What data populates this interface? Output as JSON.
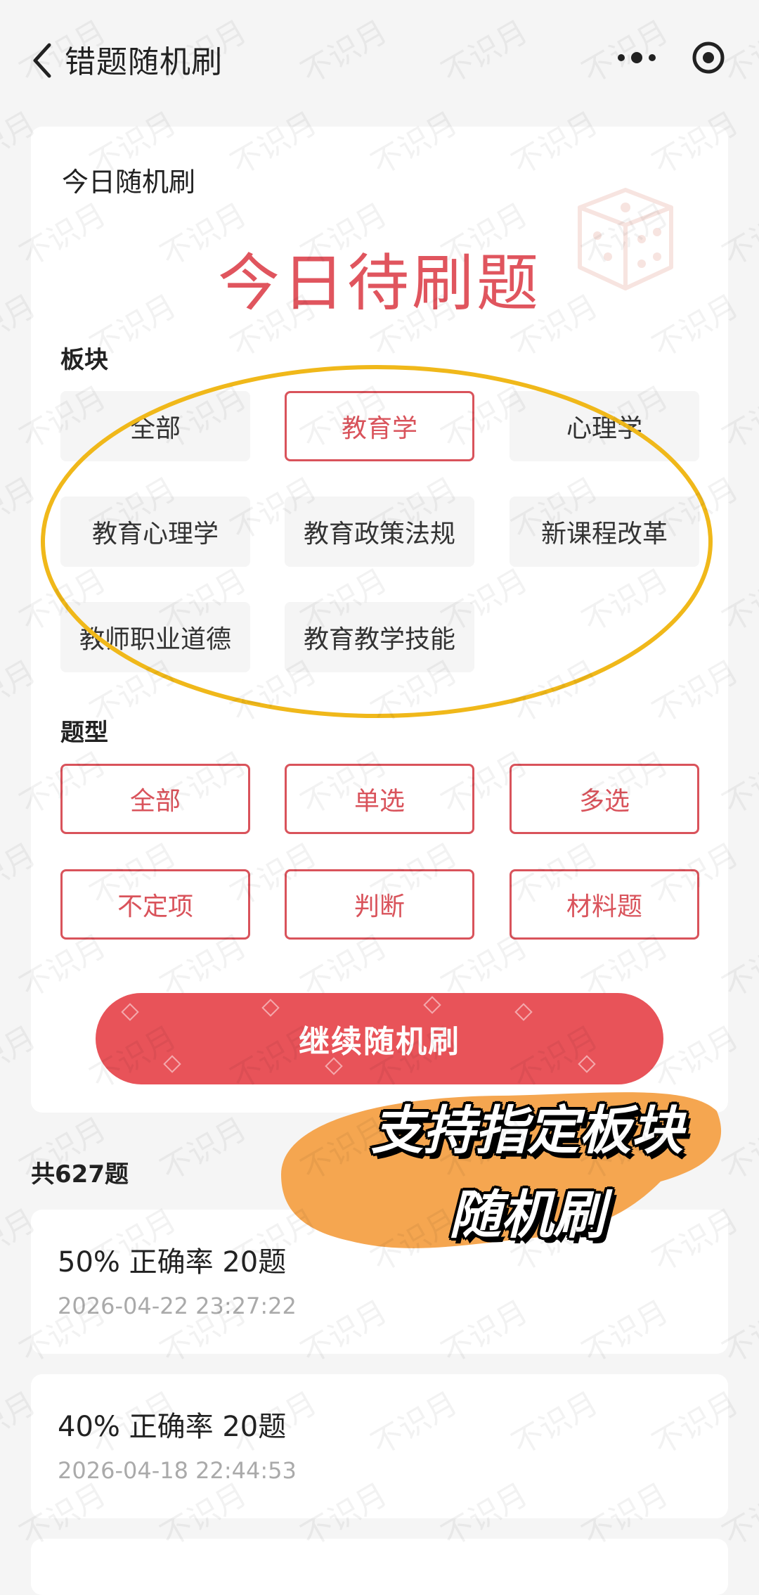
{
  "nav": {
    "title": "错题随机刷",
    "icons": [
      "back-chevron",
      "more-dots",
      "target-circle"
    ]
  },
  "main_card": {
    "label": "今日随机刷",
    "big_title": "今日待刷题",
    "section_block": "板块",
    "blocks": [
      {
        "label": "全部",
        "selected": false
      },
      {
        "label": "教育学",
        "selected": true
      },
      {
        "label": "心理学",
        "selected": false
      },
      {
        "label": "教育心理学",
        "selected": false
      },
      {
        "label": "教育政策法规",
        "selected": false
      },
      {
        "label": "新课程改革",
        "selected": false
      },
      {
        "label": "教师职业道德",
        "selected": false
      },
      {
        "label": "教育教学技能",
        "selected": false
      }
    ],
    "section_type": "题型",
    "types": [
      {
        "label": "全部",
        "selected": true
      },
      {
        "label": "单选",
        "selected": true
      },
      {
        "label": "多选",
        "selected": true
      },
      {
        "label": "不定项",
        "selected": true
      },
      {
        "label": "判断",
        "selected": true
      },
      {
        "label": "材料题",
        "selected": true
      }
    ],
    "button": "继续随机刷"
  },
  "total": "共627题",
  "records": [
    {
      "title": "50% 正确率 20题",
      "time": "2026-04-22 23:27:22"
    },
    {
      "title": "40% 正确率 20题",
      "time": "2026-04-18 22:44:53"
    }
  ],
  "promo": {
    "line1": "支持指定板块",
    "line2": "随机刷"
  },
  "watermark": "不识月",
  "colors": {
    "accent": "#e0555e",
    "button": "#e85359",
    "highlight_ellipse": "#f0b81a",
    "promo_blob": "#f5a650",
    "bg": "#f5f5f5"
  }
}
